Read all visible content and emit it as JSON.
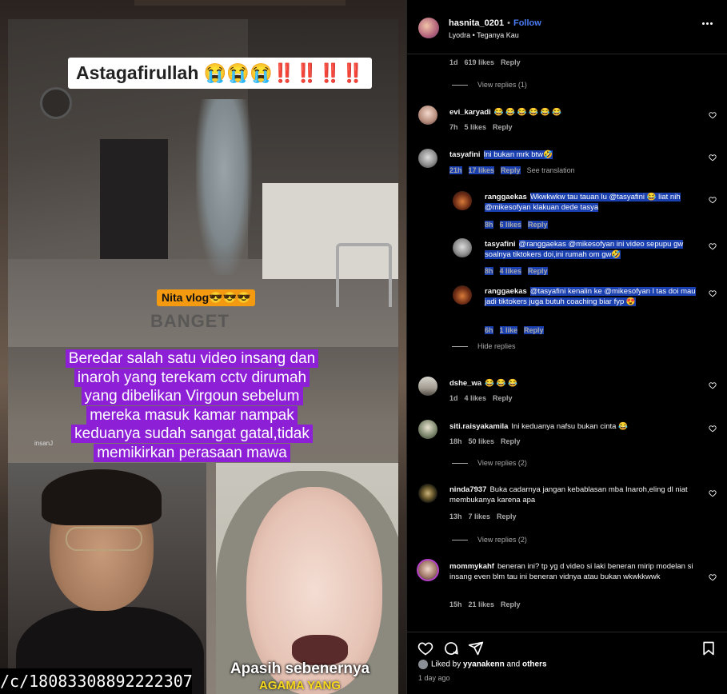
{
  "media": {
    "caption_top_text": "Astagafirullah 😭😭😭",
    "caption_top_bangs": "‼️‼️‼️‼️",
    "nita_tag": "Nita vlog😎😎😎",
    "watermark": "BANGET",
    "purple_caption": "Beredar salah satu video insang dan inaroh yang terekam cctv dirumah yang dibelikan Virgoun sebelum mereka masuk kamar nampak keduanya sudah sangat gatal,tidak memikirkan perasaan mawa",
    "insan_tag": "insanJ",
    "bottom_caption": "Apasih sebenernya",
    "bottom_caption_2": "AGAMA YANG",
    "url_fragment": "/c/18083308892222307/"
  },
  "post_header": {
    "username": "hasnita_0201",
    "follow_label": "Follow",
    "separator": "•",
    "subtitle": "Lyodra • Teganya Kau"
  },
  "comments": [
    {
      "id": "top",
      "meta": {
        "time": "1d",
        "likes": "619 likes",
        "reply": "Reply"
      },
      "view_replies": "View replies (1)"
    },
    {
      "id": "evi",
      "username": "evi_karyadi",
      "text": "😂 😂 😂 😂 😂 😂",
      "meta": {
        "time": "7h",
        "likes": "5 likes",
        "reply": "Reply"
      }
    },
    {
      "id": "tasya",
      "username": "tasyafini",
      "text": "Ini bukan mrk btw🤣",
      "meta": {
        "time": "21h",
        "likes": "17 likes",
        "reply": "Reply",
        "translate": "See translation"
      },
      "replies": [
        {
          "username": "ranggaekas",
          "text": "Wkwkwkw tau tauan lu @tasyafini 😂 liat nih @mikesofyan klakuan dede tasya",
          "meta": {
            "time": "8h",
            "likes": "6 likes",
            "reply": "Reply"
          }
        },
        {
          "username": "tasyafini",
          "text": "@ranggaekas @mikesofyan ini video sepupu gw soalnya tiktokers doi,ini rumah om gw🤣",
          "meta": {
            "time": "8h",
            "likes": "4 likes",
            "reply": "Reply"
          }
        },
        {
          "username": "ranggaekas",
          "text": "@tasyafini kenalin ke @mikesofyan l tas doi mau jadi tiktokers juga butuh coaching biar fyp 😍",
          "meta": {
            "time": "6h",
            "likes": "1 like",
            "reply": "Reply"
          }
        }
      ],
      "hide_replies": "Hide replies"
    },
    {
      "id": "dshe",
      "username": "dshe_wa",
      "text": "😂 😂 😂",
      "meta": {
        "time": "1d",
        "likes": "4 likes",
        "reply": "Reply"
      }
    },
    {
      "id": "siti",
      "username": "siti.raisyakamila",
      "text": "Ini keduanya nafsu bukan cinta 😂",
      "meta": {
        "time": "18h",
        "likes": "50 likes",
        "reply": "Reply"
      },
      "view_replies": "View replies (2)"
    },
    {
      "id": "ninda",
      "username": "ninda7937",
      "text": "Buka cadarnya jangan kebablasan mba Inaroh,eling dl niat membukanya karena apa",
      "meta": {
        "time": "13h",
        "likes": "7 likes",
        "reply": "Reply"
      },
      "view_replies": "View replies (2)"
    },
    {
      "id": "mommy",
      "username": "mommykahf",
      "text": "beneran ini? tp yg d video si laki beneran mirip modelan si insang even blm tau ini beneran vidnya atau bukan wkwkkwwk",
      "meta": {
        "time": "15h",
        "likes": "21 likes",
        "reply": "Reply"
      }
    }
  ],
  "footer": {
    "liked_by_prefix": "Liked by ",
    "liked_by_user": "yyanakenn",
    "liked_by_suffix": " and ",
    "liked_by_others": "others",
    "time_ago": "1 day ago"
  },
  "icons": {
    "heart": "heart-icon",
    "comment": "comment-icon",
    "share": "share-icon",
    "bookmark": "bookmark-icon",
    "more": "more-icon"
  },
  "colors": {
    "follow": "#4a7cf6",
    "highlight": "#1a3fae",
    "purple_caption": "#8d1fd6",
    "nita_tag": "#f39a11"
  }
}
